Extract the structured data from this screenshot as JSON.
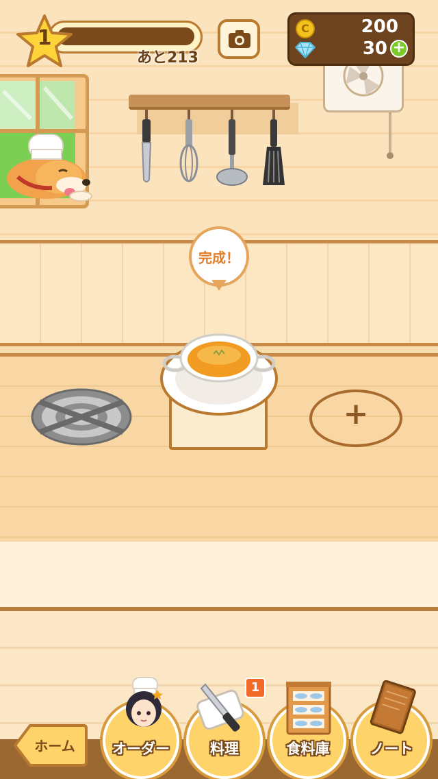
{
  "hud": {
    "level": "1",
    "xp_remaining": "あと213",
    "coins": "200",
    "gems": "30",
    "coin_symbol": "C",
    "gem_plus": "+"
  },
  "kitchen": {
    "bubble_text": "完成！",
    "add_slot_symbol": "+"
  },
  "nav": {
    "home": "ホーム",
    "order": "オーダー",
    "cooking": "料理",
    "cooking_badge": "1",
    "pantry": "食料庫",
    "note": "ノート"
  },
  "colors": {
    "accent_brown": "#b9792f",
    "nav_yellow": "#fdd36a",
    "badge_orange": "#f06a2a",
    "plus_green": "#7ccb2b"
  }
}
